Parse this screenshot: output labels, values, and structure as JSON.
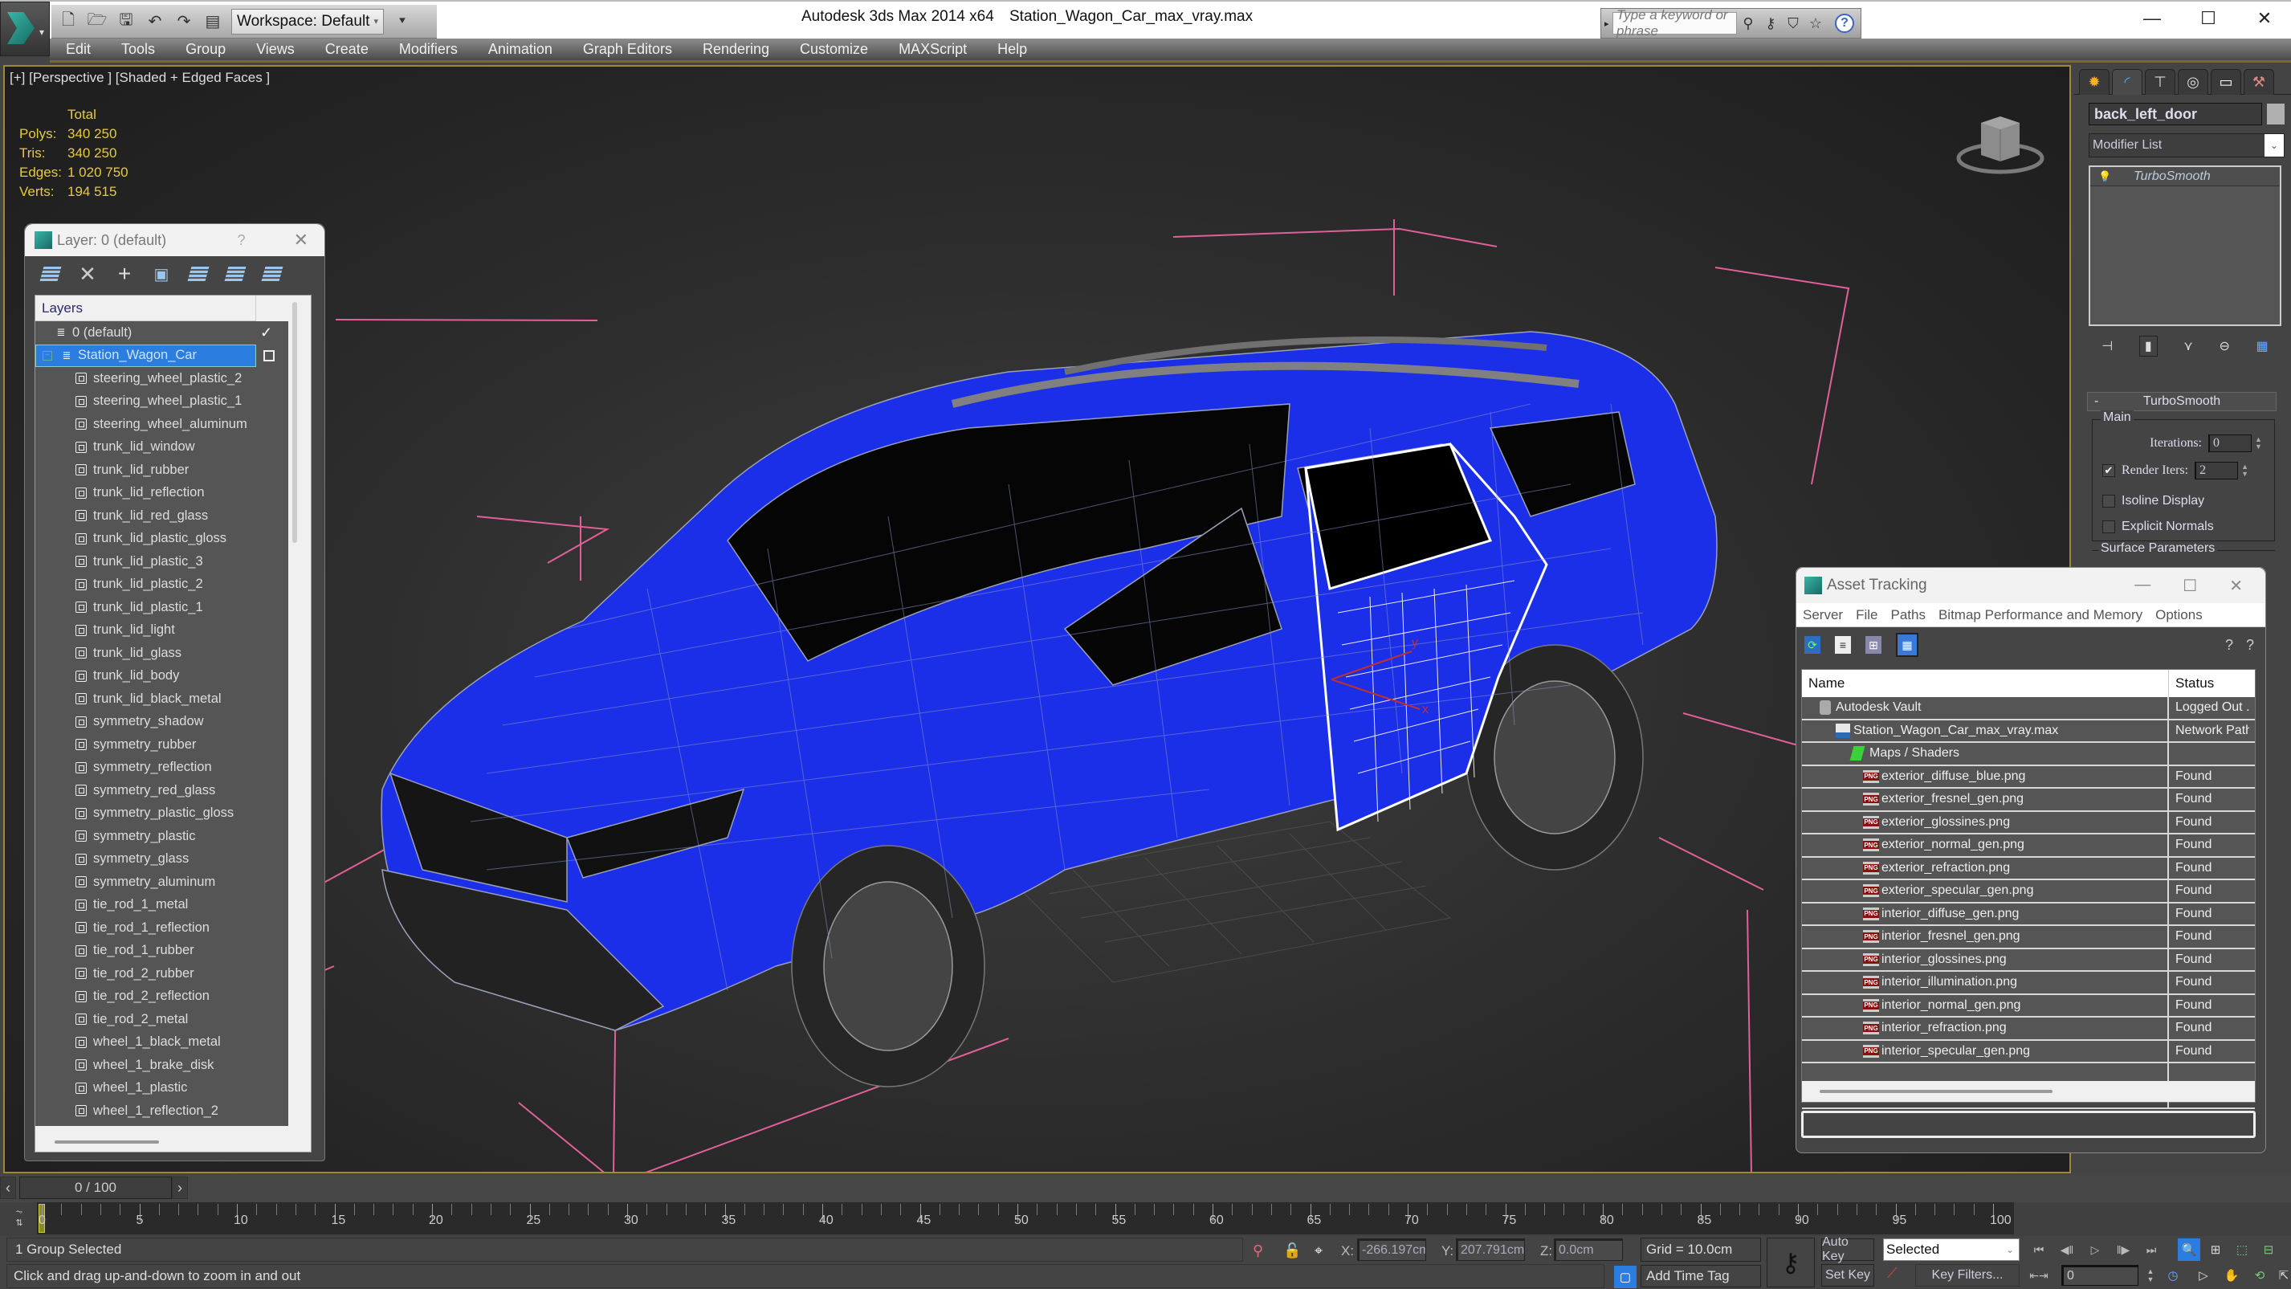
{
  "titlebar": {
    "app_title": "Autodesk 3ds Max  2014 x64",
    "file_title": "Station_Wagon_Car_max_vray.max",
    "workspace": "Workspace: Default",
    "search_placeholder": "Type a keyword or phrase",
    "window_controls": {
      "minimize": "—",
      "maximize": "☐",
      "close": "✕"
    }
  },
  "menubar": {
    "items": [
      "Edit",
      "Tools",
      "Group",
      "Views",
      "Create",
      "Modifiers",
      "Animation",
      "Graph Editors",
      "Rendering",
      "Customize",
      "MAXScript",
      "Help"
    ]
  },
  "viewport": {
    "label": "[+] [Perspective ] [Shaded + Edged Faces ]",
    "stats": {
      "header": "Total",
      "rows": [
        {
          "label": "Polys:",
          "value": "340 250"
        },
        {
          "label": "Tris:",
          "value": "340 250"
        },
        {
          "label": "Edges:",
          "value": "1 020 750"
        },
        {
          "label": "Verts:",
          "value": "194 515"
        }
      ]
    },
    "model_color": "#1a2cf0",
    "bbox_color": "#e0609a",
    "gizmo_labels": {
      "x": "x",
      "y": "y"
    }
  },
  "layer_panel": {
    "title": "Layer: 0 (default)",
    "help": "?",
    "close": "✕",
    "tree_header": "Layers",
    "layers": [
      {
        "name": "0 (default)",
        "active": true
      },
      {
        "name": "Station_Wagon_Car",
        "selected": true,
        "expanded": true
      }
    ],
    "objects": [
      "steering_wheel_plastic_2",
      "steering_wheel_plastic_1",
      "steering_wheel_aluminum",
      "trunk_lid_window",
      "trunk_lid_rubber",
      "trunk_lid_reflection",
      "trunk_lid_red_glass",
      "trunk_lid_plastic_gloss",
      "trunk_lid_plastic_3",
      "trunk_lid_plastic_2",
      "trunk_lid_plastic_1",
      "trunk_lid_light",
      "trunk_lid_glass",
      "trunk_lid_body",
      "trunk_lid_black_metal",
      "symmetry_shadow",
      "symmetry_rubber",
      "symmetry_reflection",
      "symmetry_red_glass",
      "symmetry_plastic_gloss",
      "symmetry_plastic",
      "symmetry_glass",
      "symmetry_aluminum",
      "tie_rod_1_metal",
      "tie_rod_1_reflection",
      "tie_rod_1_rubber",
      "tie_rod_2_rubber",
      "tie_rod_2_reflection",
      "tie_rod_2_metal",
      "wheel_1_black_metal",
      "wheel_1_brake_disk",
      "wheel_1_plastic",
      "wheel_1_reflection_2"
    ]
  },
  "command_panel": {
    "object_name": "back_left_door",
    "modifier_list": "Modifier List",
    "stack": [
      "TurboSmooth"
    ],
    "rollout_title": "TurboSmooth",
    "group_main": "Main",
    "iterations_label": "Iterations:",
    "iterations_value": "0",
    "render_iters_label": "Render Iters:",
    "render_iters_value": "2",
    "render_iters_checked": true,
    "isoline_label": "Isoline Display",
    "isoline_checked": false,
    "explicit_normals_label": "Explicit Normals",
    "explicit_normals_checked": false,
    "surface_params": "Surface Parameters"
  },
  "asset_tracking": {
    "title": "Asset Tracking",
    "menu": [
      "Server",
      "File",
      "Paths",
      "Bitmap Performance and Memory",
      "Options"
    ],
    "columns": [
      "Name",
      "Status"
    ],
    "rows": [
      {
        "name": "Autodesk Vault",
        "status": "Logged Out .",
        "type": "vault",
        "indent": 1
      },
      {
        "name": "Station_Wagon_Car_max_vray.max",
        "status": "Network Path",
        "type": "max",
        "indent": 2
      },
      {
        "name": "Maps / Shaders",
        "status": "",
        "type": "maps",
        "indent": 3
      },
      {
        "name": "exterior_diffuse_blue.png",
        "status": "Found",
        "type": "png",
        "indent": 4
      },
      {
        "name": "exterior_fresnel_gen.png",
        "status": "Found",
        "type": "png",
        "indent": 4
      },
      {
        "name": "exterior_glossines.png",
        "status": "Found",
        "type": "png",
        "indent": 4
      },
      {
        "name": "exterior_normal_gen.png",
        "status": "Found",
        "type": "png",
        "indent": 4
      },
      {
        "name": "exterior_refraction.png",
        "status": "Found",
        "type": "png",
        "indent": 4
      },
      {
        "name": "exterior_specular_gen.png",
        "status": "Found",
        "type": "png",
        "indent": 4
      },
      {
        "name": "interior_diffuse_gen.png",
        "status": "Found",
        "type": "png",
        "indent": 4
      },
      {
        "name": "interior_fresnel_gen.png",
        "status": "Found",
        "type": "png",
        "indent": 4
      },
      {
        "name": "interior_glossines.png",
        "status": "Found",
        "type": "png",
        "indent": 4
      },
      {
        "name": "interior_illumination.png",
        "status": "Found",
        "type": "png",
        "indent": 4
      },
      {
        "name": "interior_normal_gen.png",
        "status": "Found",
        "type": "png",
        "indent": 4
      },
      {
        "name": "interior_refraction.png",
        "status": "Found",
        "type": "png",
        "indent": 4
      },
      {
        "name": "interior_specular_gen.png",
        "status": "Found",
        "type": "png",
        "indent": 4
      }
    ]
  },
  "timeline": {
    "slider_text": "0 / 100",
    "current_frame": 0,
    "start": 0,
    "end": 100,
    "label_step": 5
  },
  "statusbar": {
    "selection": "1 Group Selected",
    "prompt": "Click and drag up-and-down to zoom in and out",
    "x_label": "X:",
    "x_value": "-266.197cm",
    "y_label": "Y:",
    "y_value": "207.791cm",
    "z_label": "Z:",
    "z_value": "0.0cm",
    "grid": "Grid = 10.0cm",
    "add_time_tag": "Add Time Tag",
    "auto_key": "Auto Key",
    "set_key": "Set Key",
    "key_mode": "Selected",
    "key_filters": "Key Filters...",
    "frame_value": "0"
  }
}
